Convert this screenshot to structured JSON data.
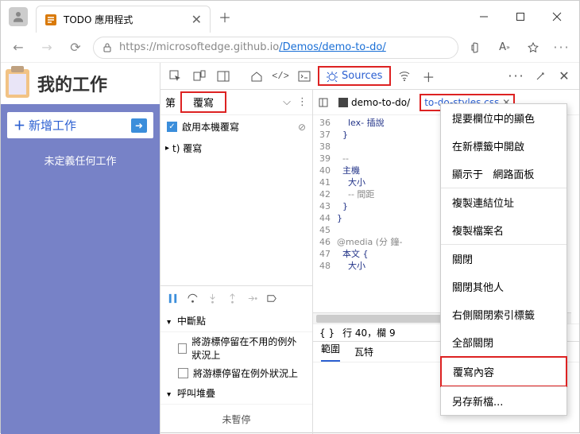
{
  "tab": {
    "title": "TODO 應用程式"
  },
  "address": {
    "protocol_host": "https://microsoftedge.github.io",
    "path": "/Demos/demo-to-do/"
  },
  "page": {
    "title": "我的工作",
    "add": "新增工作",
    "empty": "未定義任何工作"
  },
  "devtools": {
    "sources_label": "Sources",
    "nav": {
      "first": "第",
      "overrides": "覆寫",
      "enable": "啟用本機覆寫",
      "tree_root": "t) 覆寫"
    },
    "codeTabs": {
      "demo": "demo-to-do/",
      "css": "to-do-styles.css"
    },
    "code": {
      "lines": [
        "36",
        "37",
        "38",
        "39",
        "40",
        "41",
        "42",
        "43",
        "44",
        "45",
        "46",
        "47",
        "48"
      ],
      "text": [
        "    lex- 插說",
        "  }",
        "",
        "  --",
        "  主機",
        "    大小",
        "    -- 間距",
        "  }",
        "}",
        "",
        "@media (分 鐘-",
        "  本文 {",
        "    大小"
      ]
    },
    "status": {
      "brackets": "{ }",
      "pos": "行 40，欄 9"
    },
    "debugger": {
      "scope": "範圍",
      "watch": "瓦特",
      "breakpoints": "中斷點",
      "bp1": "將游標停留在不用的例外狀況上",
      "bp2": "將游標停留在例外狀況上",
      "callstack": "呼叫堆疊",
      "not_paused": "未暫停"
    }
  },
  "ctx": {
    "i1": "提要欄位中的顯色",
    "i2": "在新標籤中開啟",
    "i3a": "顯示于",
    "i3b": "網路面板",
    "i4": "複製連結位址",
    "i5": "複製檔案名",
    "i6": "關閉",
    "i7": "關閉其他人",
    "i8": "右側關閉索引標籤",
    "i9": "全部關閉",
    "i10": "覆寫內容",
    "i11": "另存新檔..."
  }
}
